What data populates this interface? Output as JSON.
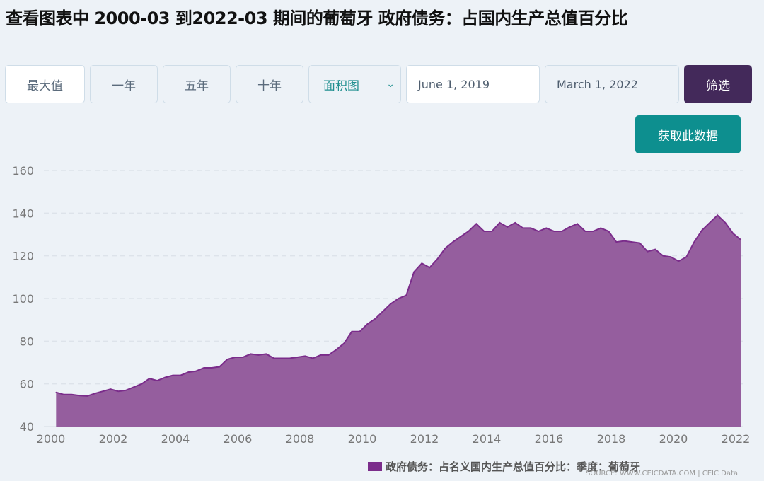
{
  "title": "查看图表中 2000-03 到2022-03 期间的葡萄牙 政府债务：占国内生产总值百分比",
  "controls": {
    "max": "最大值",
    "one_year": "一年",
    "five_year": "五年",
    "ten_year": "十年",
    "chart_type": "面积图",
    "start_date": "June 1, 2019",
    "end_date": "March 1, 2022",
    "filter": "筛选",
    "get_data": "获取此数据"
  },
  "colors": {
    "area": "#955e9e",
    "line": "#7b2d8b",
    "filter_button": "#43295a",
    "get_data_button": "#0d8f8f"
  },
  "source": "SOURCE: WWW.CEICDATA.COM | CEIC Data",
  "chart_data": {
    "type": "area",
    "title": "",
    "xlabel": "",
    "ylabel": "",
    "ylim": [
      40,
      160
    ],
    "xlim": [
      2000,
      2022
    ],
    "yticks": [
      "40",
      "60",
      "80",
      "100",
      "120",
      "140",
      "160"
    ],
    "xticks": [
      "2000",
      "2002",
      "2004",
      "2006",
      "2008",
      "2010",
      "2012",
      "2014",
      "2016",
      "2018",
      "2020",
      "2022"
    ],
    "grid": true,
    "legend_position": "bottom-right",
    "start": "2000-03",
    "frequency": "quarterly",
    "series": [
      {
        "name": "政府债务：占名义国内生产总值百分比：季度：葡萄牙",
        "values": [
          56,
          55,
          55,
          54.5,
          54.3,
          55.5,
          56.5,
          57.5,
          56.5,
          57,
          58.5,
          60,
          62.5,
          61.5,
          63,
          64,
          64,
          65.5,
          66,
          67.5,
          67.5,
          68,
          71.5,
          72.5,
          72.5,
          74,
          73.5,
          74,
          72,
          72,
          72,
          72.5,
          73,
          72,
          73.5,
          73.5,
          76,
          79,
          84.5,
          84.5,
          88,
          90.5,
          94,
          97.5,
          100,
          101.5,
          112.5,
          116.5,
          114.5,
          118.5,
          123.5,
          126.5,
          129,
          131.5,
          135,
          131.5,
          131.5,
          135.5,
          133.5,
          135.5,
          133,
          133,
          131.5,
          133,
          131.5,
          131.5,
          133.5,
          135,
          131.5,
          131.5,
          133,
          131.5,
          126.5,
          127,
          126.5,
          126,
          122,
          123,
          120,
          119.5,
          117.5,
          119.5,
          126.5,
          132,
          135.5,
          139,
          135.5,
          130.5,
          127.5
        ]
      }
    ]
  }
}
